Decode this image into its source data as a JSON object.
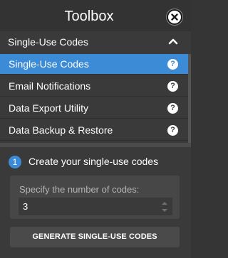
{
  "toolbox": {
    "title": "Toolbox"
  },
  "section": {
    "label": "Single-Use Codes"
  },
  "menu": {
    "items": [
      {
        "label": "Single-Use Codes",
        "help": "?"
      },
      {
        "label": "Email Notifications",
        "help": "?"
      },
      {
        "label": "Data Export Utility",
        "help": "?"
      },
      {
        "label": "Data Backup & Restore",
        "help": "?"
      }
    ]
  },
  "step": {
    "number": "1",
    "text": "Create your single-use codes"
  },
  "codes_input": {
    "label": "Specify the number of codes:",
    "value": "3"
  },
  "generate_button": {
    "label": "GENERATE SINGLE-USE CODES"
  },
  "colors": {
    "accent": "#3b8bd6",
    "background": "#3a3a3a"
  }
}
